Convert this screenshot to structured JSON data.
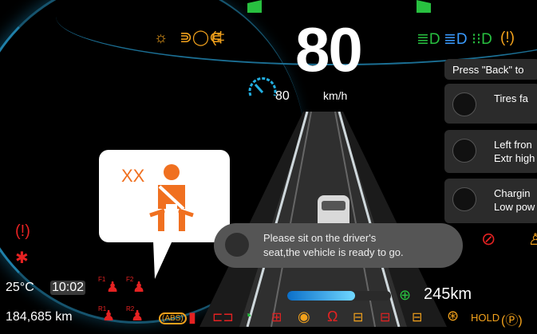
{
  "speed": {
    "value": "80",
    "unit": "km/h",
    "limit": "80"
  },
  "notifications": [
    {
      "text_line1": "Press \"Back\" to",
      "text_line2": ""
    },
    {
      "text_line1": "Tires fa",
      "text_line2": ""
    },
    {
      "text_line1": "Left fron",
      "text_line2": "Extr high"
    },
    {
      "text_line1": "Chargin",
      "text_line2": "Low pow"
    }
  ],
  "popup": {
    "code": "XX"
  },
  "message": {
    "line1": "Please sit on the driver's",
    "line2": "seat,the vehicle is ready to go."
  },
  "status": {
    "temperature": "25°C",
    "time": "10:02",
    "odometer": "184,685 km",
    "range": "245km",
    "seat_labels": [
      "F1",
      "F2",
      "R1",
      "R2"
    ],
    "hold": "HOLD",
    "abs": "(ABS)",
    "battery_level": 0.65
  },
  "colors": {
    "accent": "#1f7fa8",
    "warning": "#e52222",
    "ok": "#28c040",
    "amber": "#f3a21c",
    "info": "#3a9bff"
  }
}
